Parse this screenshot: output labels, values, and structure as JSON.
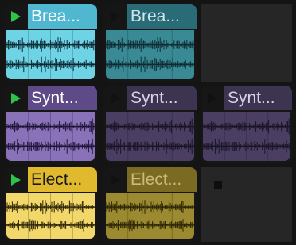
{
  "clips": [
    {
      "id": "r1c1",
      "name": "Brea...",
      "state": "playing",
      "header_color": "#4fb8d0",
      "wave_bg": "#6fd3e6",
      "wave_fg": "#0b2a33",
      "play_color": "#2ec44a"
    },
    {
      "id": "r1c2",
      "name": "Brea...",
      "state": "stopped",
      "header_color": "#2a6b78",
      "wave_bg": "#3a8a96",
      "wave_fg": "#0f2c32",
      "play_color": "#1a1a1a"
    },
    {
      "id": "r2c1",
      "name": "Synt...",
      "state": "playing",
      "header_color": "#5e4a86",
      "wave_bg": "#8a72b8",
      "wave_fg": "#1f1538",
      "play_color": "#2ec44a"
    },
    {
      "id": "r2c2",
      "name": "Synt...",
      "state": "stopped",
      "header_color": "#3d3452",
      "wave_bg": "#4a3f63",
      "wave_fg": "#1a1527",
      "play_color": "#1a1a1a"
    },
    {
      "id": "r2c3",
      "name": "Synt...",
      "state": "stopped",
      "header_color": "#3d3452",
      "wave_bg": "#4a3f63",
      "wave_fg": "#1a1527",
      "play_color": "#1a1a1a"
    },
    {
      "id": "r3c1",
      "name": "Elect...",
      "state": "playing",
      "header_color": "#e0b92e",
      "wave_bg": "#f2d76a",
      "wave_fg": "#2a2205",
      "play_color": "#2ec44a"
    },
    {
      "id": "r3c2",
      "name": "Elect...",
      "state": "stopped",
      "header_color": "#7a6a22",
      "wave_bg": "#9c8a30",
      "wave_fg": "#2a2405",
      "play_color": "#1a1a1a"
    }
  ]
}
